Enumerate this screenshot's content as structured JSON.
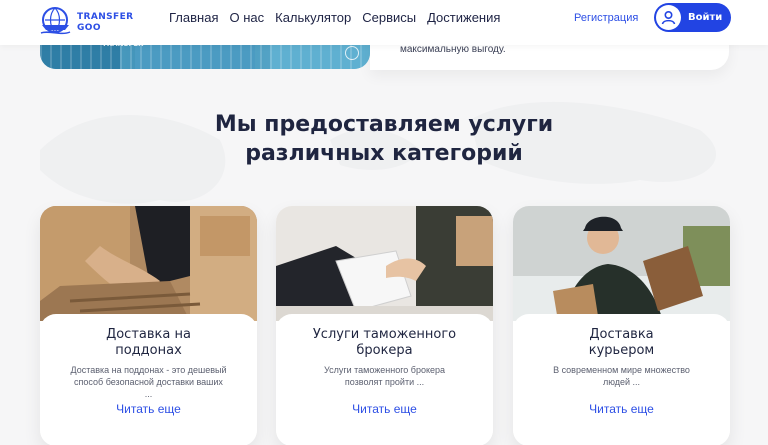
{
  "header": {
    "logo_line1": "TRANSFER",
    "logo_line2": "GOO",
    "nav": [
      "Главная",
      "О нас",
      "Калькулятор",
      "Сервисы",
      "Достижения"
    ],
    "register": "Регистрация",
    "login": "Войти"
  },
  "top": {
    "container_badge": "TRANSFER",
    "text": "максимальную выгоду."
  },
  "section": {
    "title_line1": "Мы предоставляем услуги",
    "title_line2": "различных категорий"
  },
  "cards": [
    {
      "title1": "Доставка на",
      "title2": "поддонах",
      "desc1": "Доставка на поддонах - это дешевый",
      "desc2": "способ безопасной доставки ваших",
      "desc3": "...",
      "more": "Читать еще"
    },
    {
      "title1": "Услуги таможенного",
      "title2": "брокера",
      "desc1": "Услуги таможенного брокера",
      "desc2": "позволят пройти ...",
      "desc3": "",
      "more": "Читать еще"
    },
    {
      "title1": "Доставка",
      "title2": "курьером",
      "desc1": "В современном мире множество",
      "desc2": "людей ...",
      "desc3": "",
      "more": "Читать еще"
    }
  ],
  "colors": {
    "accent": "#2244e3",
    "title": "#1f2540"
  }
}
